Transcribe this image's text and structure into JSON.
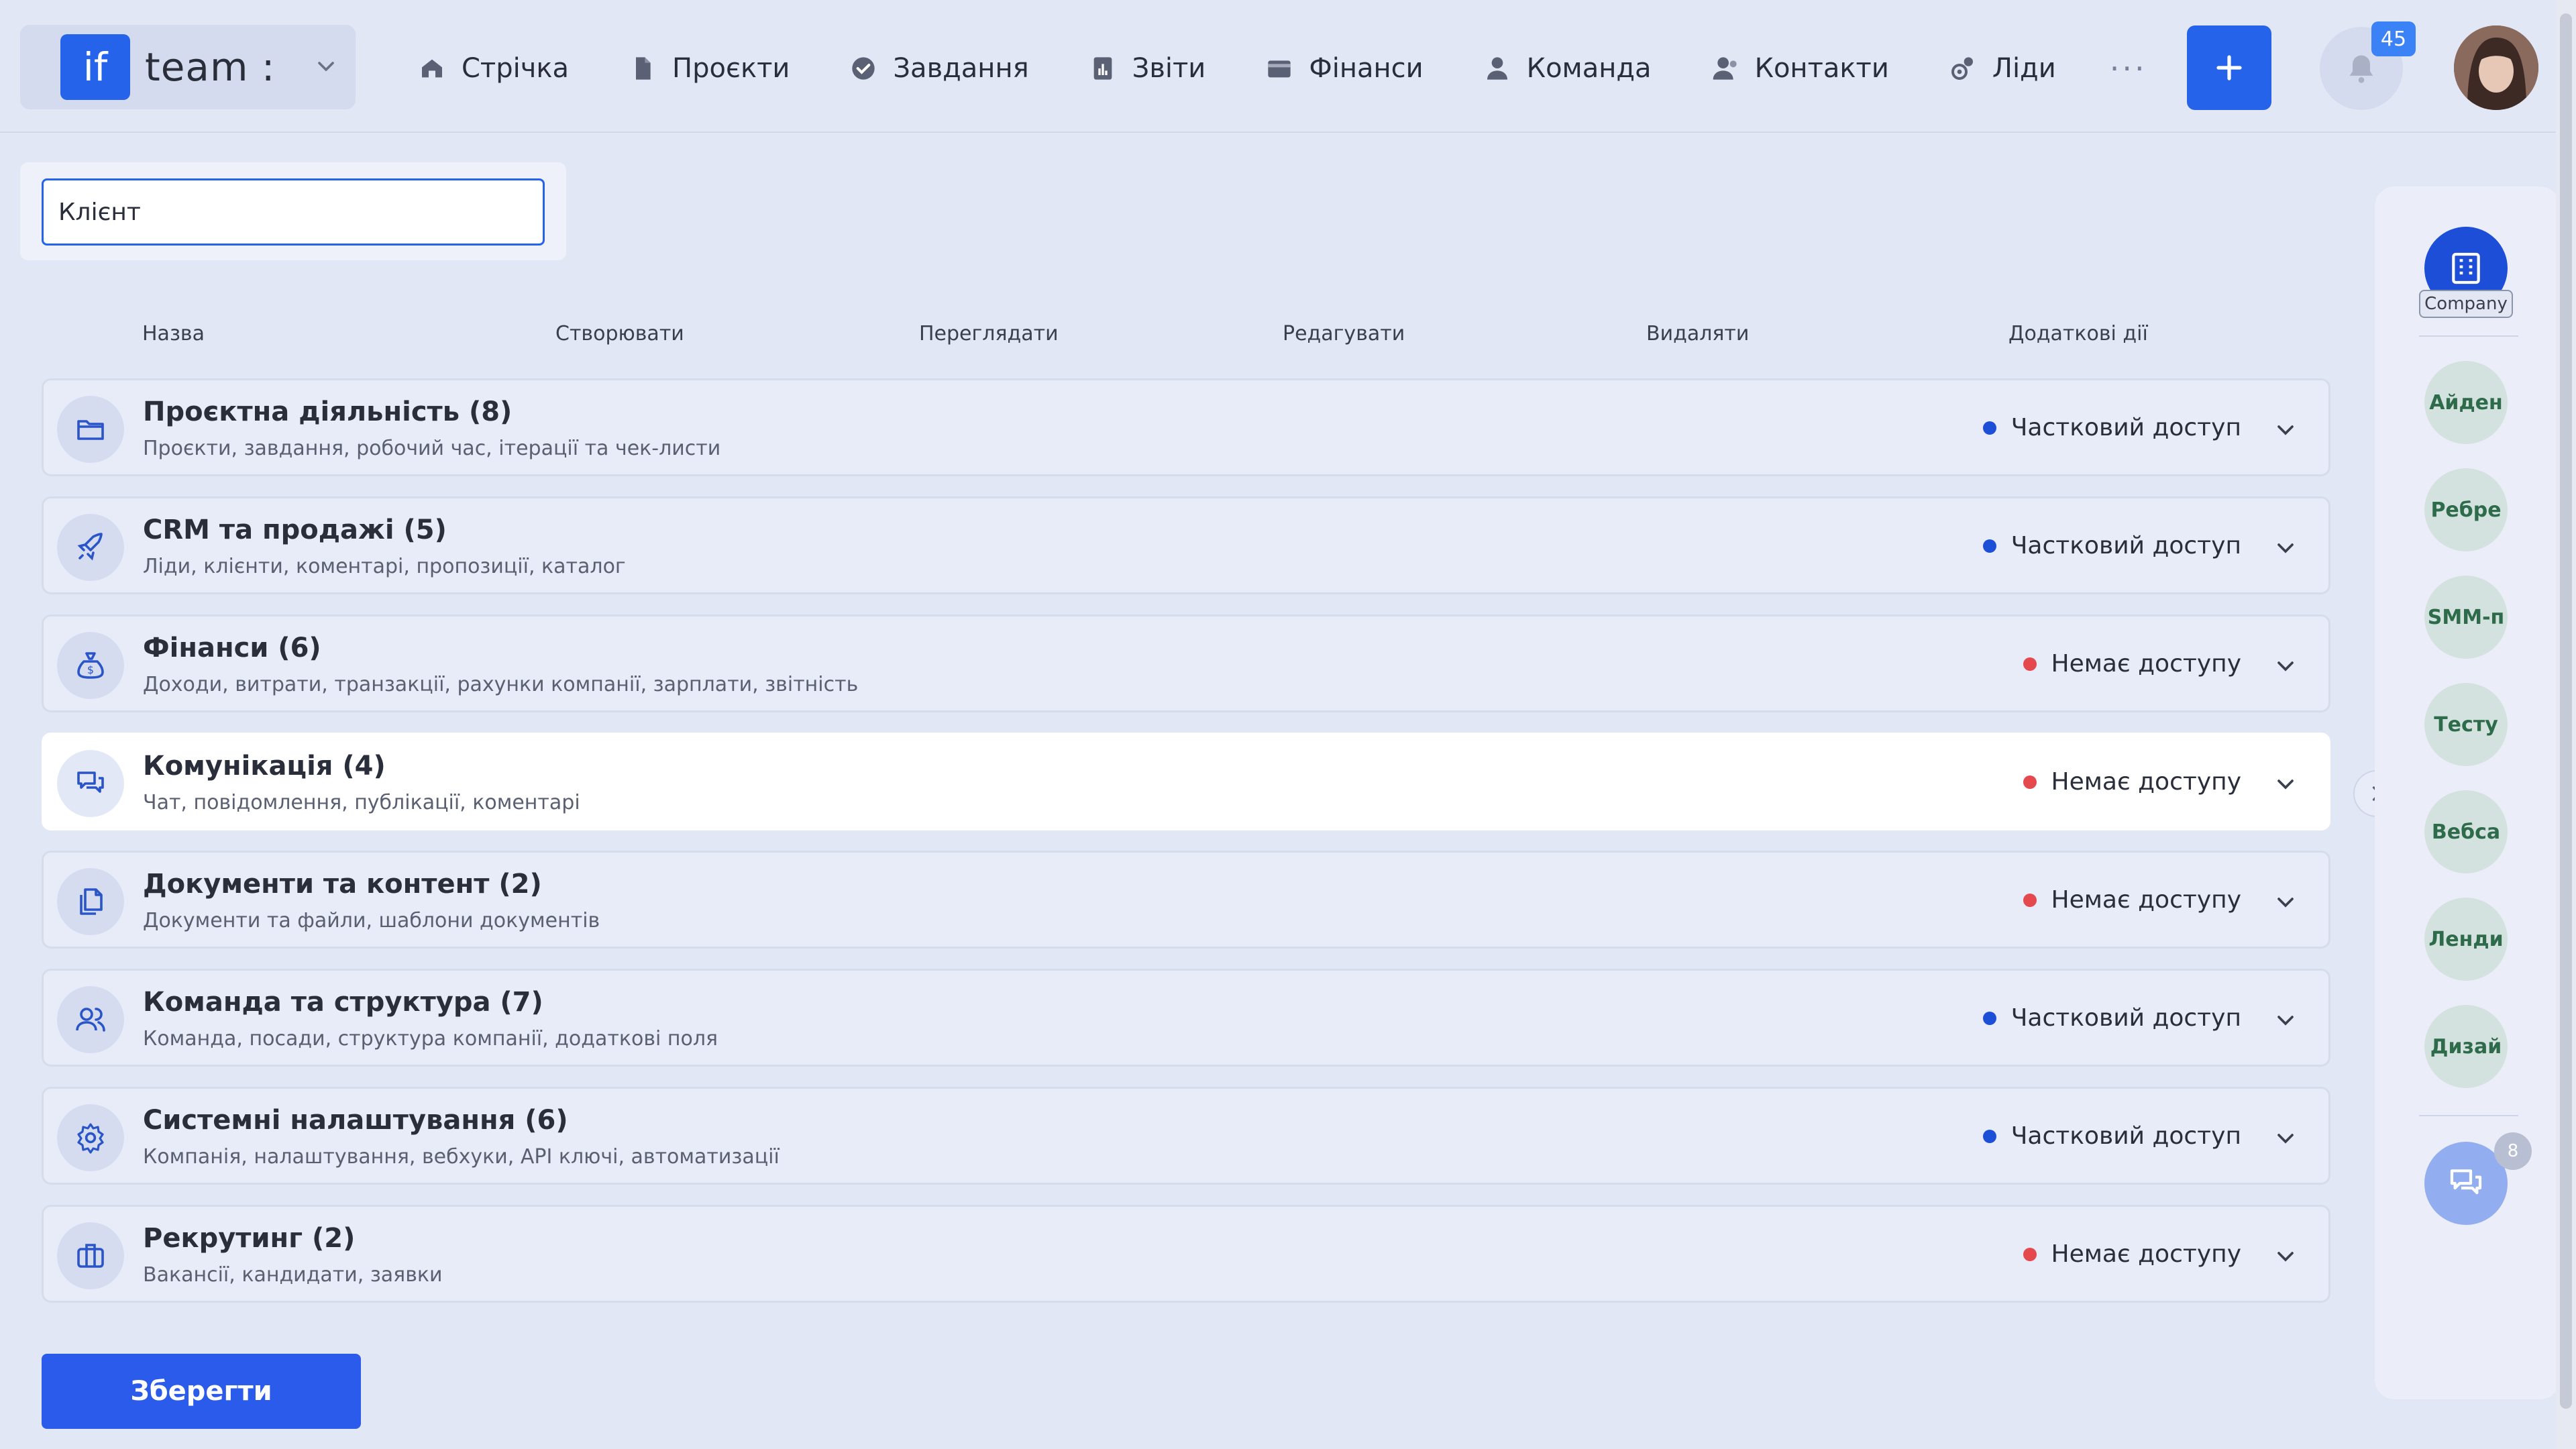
{
  "header": {
    "logo_text": "if",
    "team_label": "team :",
    "nav": [
      {
        "label": "Стрічка",
        "icon": "home-icon"
      },
      {
        "label": "Проєкти",
        "icon": "file-icon"
      },
      {
        "label": "Завдання",
        "icon": "check-circle-icon"
      },
      {
        "label": "Звіти",
        "icon": "report-icon"
      },
      {
        "label": "Фінанси",
        "icon": "wallet-icon"
      },
      {
        "label": "Команда",
        "icon": "user-icon"
      },
      {
        "label": "Контакти",
        "icon": "contacts-icon"
      },
      {
        "label": "Ліди",
        "icon": "leads-icon"
      }
    ],
    "more_label": "···",
    "notifications_count": "45"
  },
  "filter": {
    "role_value": "Клієнт"
  },
  "columns": [
    "Назва",
    "Створювати",
    "Переглядати",
    "Редагувати",
    "Видаляти",
    "Додаткові дії"
  ],
  "permissions": [
    {
      "title": "Проєктна діяльність (8)",
      "desc": "Проєкти, завдання, робочий час, ітерації та чек-листи",
      "status": "Частковий доступ",
      "icon": "folder-icon"
    },
    {
      "title": "CRM та продажі (5)",
      "desc": "Ліди, клієнти, коментарі, пропозиції, каталог",
      "status": "Частковий доступ",
      "icon": "rocket-icon"
    },
    {
      "title": "Фінанси (6)",
      "desc": "Доходи, витрати, транзакції, рахунки компанії, зарплати, звітність",
      "status": "Немає доступу",
      "icon": "money-bag-icon"
    },
    {
      "title": "Комунікація (4)",
      "desc": "Чат, повідомлення, публікації, коментарі",
      "status": "Немає доступу",
      "icon": "chat-icon"
    },
    {
      "title": "Документи та контент (2)",
      "desc": "Документи та файли, шаблони документів",
      "status": "Немає доступу",
      "icon": "documents-icon"
    },
    {
      "title": "Команда та структура (7)",
      "desc": "Команда, посади, структура компанії, додаткові поля",
      "status": "Частковий доступ",
      "icon": "team-icon"
    },
    {
      "title": "Системні налаштування (6)",
      "desc": "Компанія, налаштування, вебхуки, API ключі, автоматизації",
      "status": "Частковий доступ",
      "icon": "gear-icon"
    },
    {
      "title": "Рекрутинг (2)",
      "desc": "Вакансії, кандидати, заявки",
      "status": "Немає доступу",
      "icon": "briefcase-icon"
    }
  ],
  "status_colors": {
    "partial": "#1d4ed8",
    "none": "#e5484d"
  },
  "save_label": "Зберегти",
  "side_panel": {
    "company_label": "Company",
    "teams": [
      "Айден",
      "Ребре",
      "SMM-п",
      "Тесту",
      "Вебса",
      "Ленди",
      "Дизай"
    ],
    "chat_badge": "8"
  },
  "colors": {
    "accent": "#2563eb",
    "background": "#e2e7f5"
  }
}
